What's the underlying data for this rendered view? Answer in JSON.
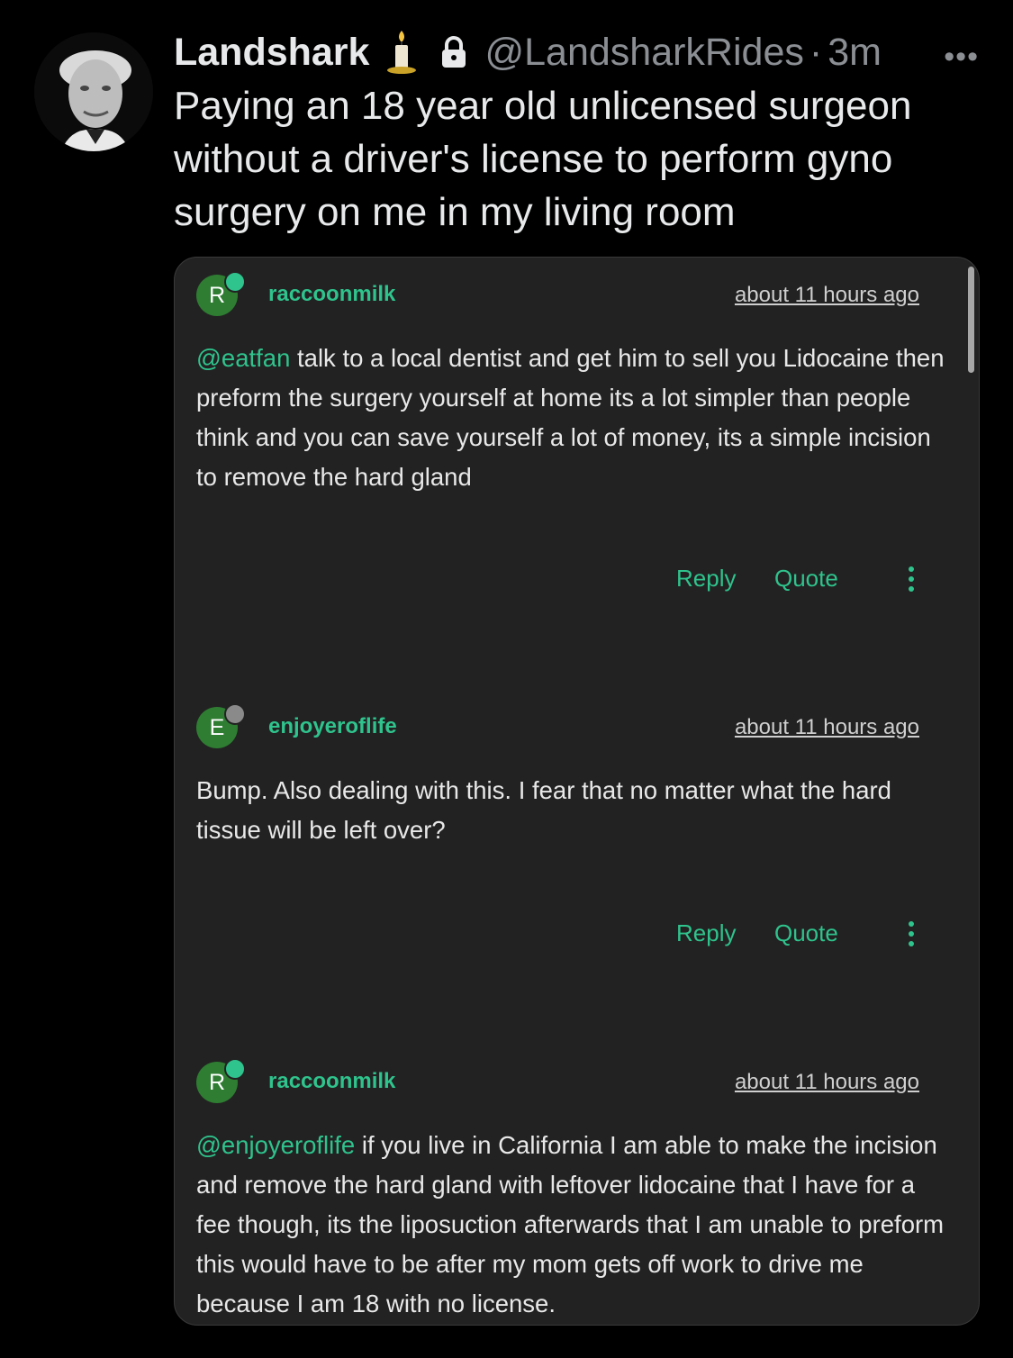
{
  "tweet": {
    "display_name": "Landshark",
    "handle": "@LandsharkRides",
    "separator": "·",
    "time": "3m",
    "more_label": "•••",
    "text": "Paying an 18 year old unlicensed surgeon without a driver's license to perform gyno surgery on me in my living room"
  },
  "comments": [
    {
      "avatar_letter": "R",
      "avatar_color": "#2e7d32",
      "status_color": "#2fc38d",
      "username": "raccoonmilk",
      "time": "about 11 hours ago",
      "mention": "@eatfan",
      "body": " talk to a local dentist and get him to sell you Lidocaine then preform the surgery yourself at home its a lot simpler than people think and you can save yourself a lot of money, its a simple incision to remove the hard gland",
      "reply_label": "Reply",
      "quote_label": "Quote"
    },
    {
      "avatar_letter": "E",
      "avatar_color": "#2e7d32",
      "status_color": "#8a8a8a",
      "username": "enjoyeroflife",
      "time": "about 11 hours ago",
      "mention": "",
      "body": "Bump. Also dealing with this. I fear that no matter what the hard tissue will be left over?",
      "reply_label": "Reply",
      "quote_label": "Quote"
    },
    {
      "avatar_letter": "R",
      "avatar_color": "#2e7d32",
      "status_color": "#2fc38d",
      "username": "raccoonmilk",
      "time": "about 11 hours ago",
      "mention": "@enjoyeroflife",
      "body": " if you live in California I am able to make the incision and remove the hard gland with leftover lidocaine that I have for a fee though, its the liposuction afterwards that I am unable to preform this would have to be after my mom gets off work to drive me because I am 18 with no license."
    }
  ]
}
